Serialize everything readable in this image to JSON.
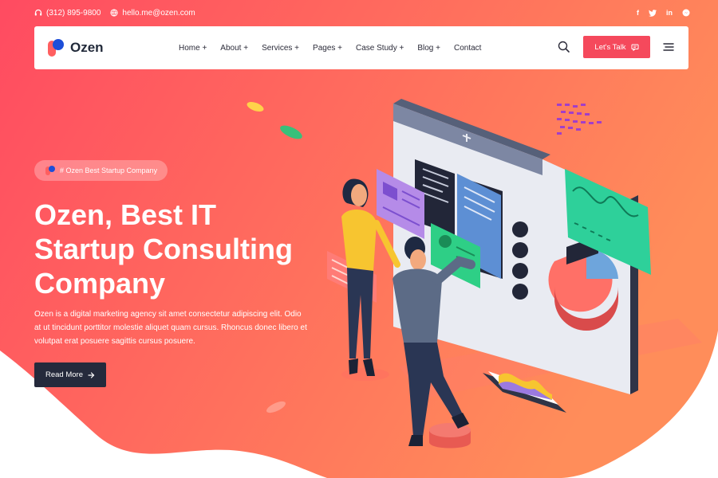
{
  "topbar": {
    "phone": "(312) 895-9800",
    "email": "hello.me@ozen.com",
    "socials": [
      "facebook-icon",
      "twitter-icon",
      "linkedin-icon",
      "messenger-icon"
    ]
  },
  "brand": {
    "name": "Ozen"
  },
  "nav": {
    "items": [
      {
        "label": "Home +"
      },
      {
        "label": "About +"
      },
      {
        "label": "Services +"
      },
      {
        "label": "Pages +"
      },
      {
        "label": "Case Study +"
      },
      {
        "label": "Blog +"
      },
      {
        "label": "Contact"
      }
    ],
    "cta_label": "Let's Talk"
  },
  "hero": {
    "badge": "# Ozen Best Startup Company",
    "headline_line1": "Ozen, Best IT",
    "headline_line2": "Startup Consulting",
    "headline_line3": "Company",
    "description": "Ozen is a digital marketing agency sit amet consectetur adipiscing elit. Odio at ut tincidunt porttitor molestie aliquet quam cursus. Rhoncus donec libero et volutpat erat posuere sagittis cursus posuere.",
    "button_label": "Read More"
  },
  "colors": {
    "gradient_start": "#ff4f62",
    "gradient_end": "#ff8a5b",
    "cta": "#f5495c",
    "dark_button": "#252a3c",
    "brand_blue": "#1d4ed8"
  }
}
